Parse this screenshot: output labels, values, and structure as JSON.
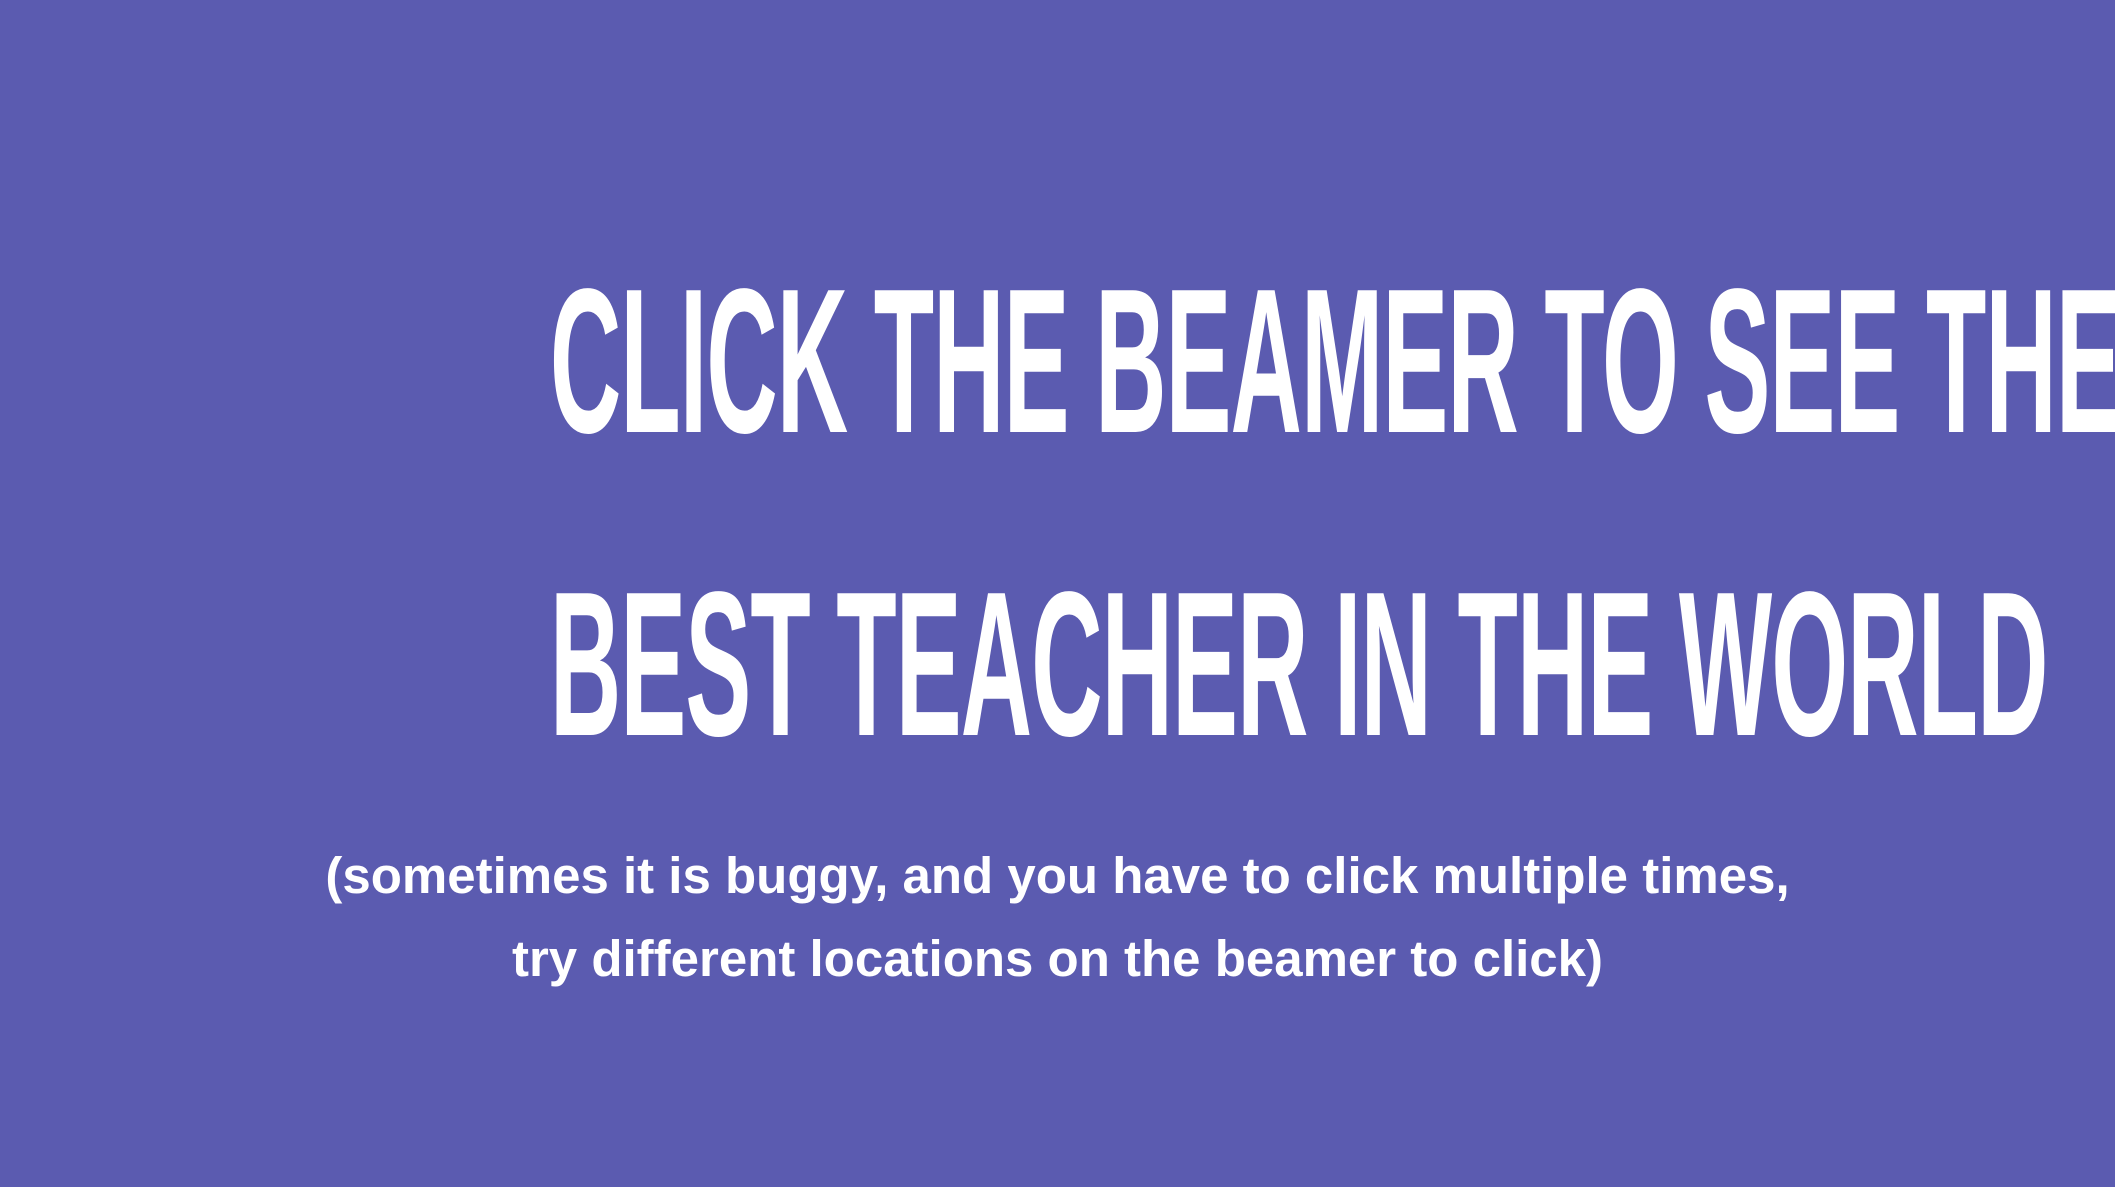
{
  "slide": {
    "background_color": "#5b5bb0",
    "text_color": "#ffffff",
    "headline": {
      "line1": "CLICK THE BEAMER TO SEE THE",
      "line2": "BEST TEACHER IN THE WORLD"
    },
    "note": {
      "line1": "(sometimes it is buggy, and you have to click multiple times,",
      "line2": "try different locations on the beamer to click)"
    }
  }
}
